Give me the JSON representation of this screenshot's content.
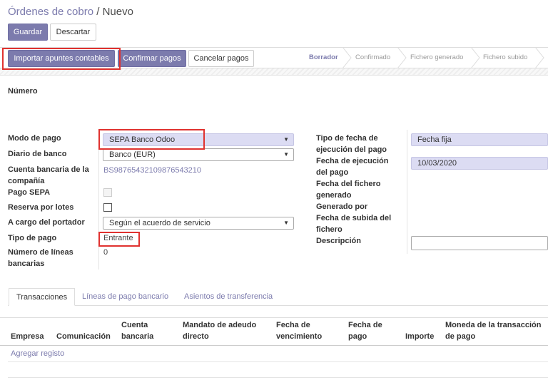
{
  "breadcrumb": {
    "parent": "Órdenes de cobro",
    "separator": " / ",
    "current": "Nuevo"
  },
  "form_buttons": {
    "save": "Guardar",
    "discard": "Descartar"
  },
  "action_buttons": {
    "import": "Importar apuntes contables",
    "confirm": "Confirmar pagos",
    "cancel": "Cancelar pagos"
  },
  "status_steps": [
    "Borrador",
    "Confirmado",
    "Fichero generado",
    "Fichero subido"
  ],
  "fields": {
    "number_label": "Número",
    "payment_mode": {
      "label": "Modo de pago",
      "value": "SEPA Banco Odoo"
    },
    "bank_journal": {
      "label": "Diario de banco",
      "value": "Banco (EUR)"
    },
    "company_account": {
      "label": "Cuenta bancaria de la compañía",
      "value": "BS98765432109876543210"
    },
    "sepa_payment": {
      "label": "Pago SEPA"
    },
    "batch_booking": {
      "label": "Reserva por lotes"
    },
    "charge_bearer": {
      "label": "A cargo del portador",
      "value": "Según el acuerdo de servicio"
    },
    "payment_type": {
      "label": "Tipo de pago",
      "value": "Entrante"
    },
    "bank_lines_count": {
      "label": "Número de líneas bancarias",
      "value": "0"
    },
    "date_prefered": {
      "label": "Tipo de fecha de ejecución del pago",
      "value": "Fecha fija"
    },
    "date_scheduled": {
      "label": "Fecha de ejecución del pago",
      "value": "10/03/2020"
    },
    "date_generated": {
      "label": "Fecha del fichero generado"
    },
    "generated_by": {
      "label": "Generado por"
    },
    "date_uploaded": {
      "label": "Fecha de subida del fichero"
    },
    "description": {
      "label": "Descripción"
    }
  },
  "tabs": [
    "Transacciones",
    "Líneas de pago bancario",
    "Asientos de transferencia"
  ],
  "table": {
    "columns": [
      "Empresa",
      "Comunicación",
      "Cuenta bancaria",
      "Mandato de adeudo directo",
      "Fecha de vencimiento",
      "Fecha de pago",
      "Importe",
      "Moneda de la transacción de pago"
    ],
    "add_row": "Agregar registo"
  },
  "colors": {
    "primary": "#7c7bad",
    "highlight_field": "#dcdcf3",
    "annotation": "#e0322f"
  }
}
